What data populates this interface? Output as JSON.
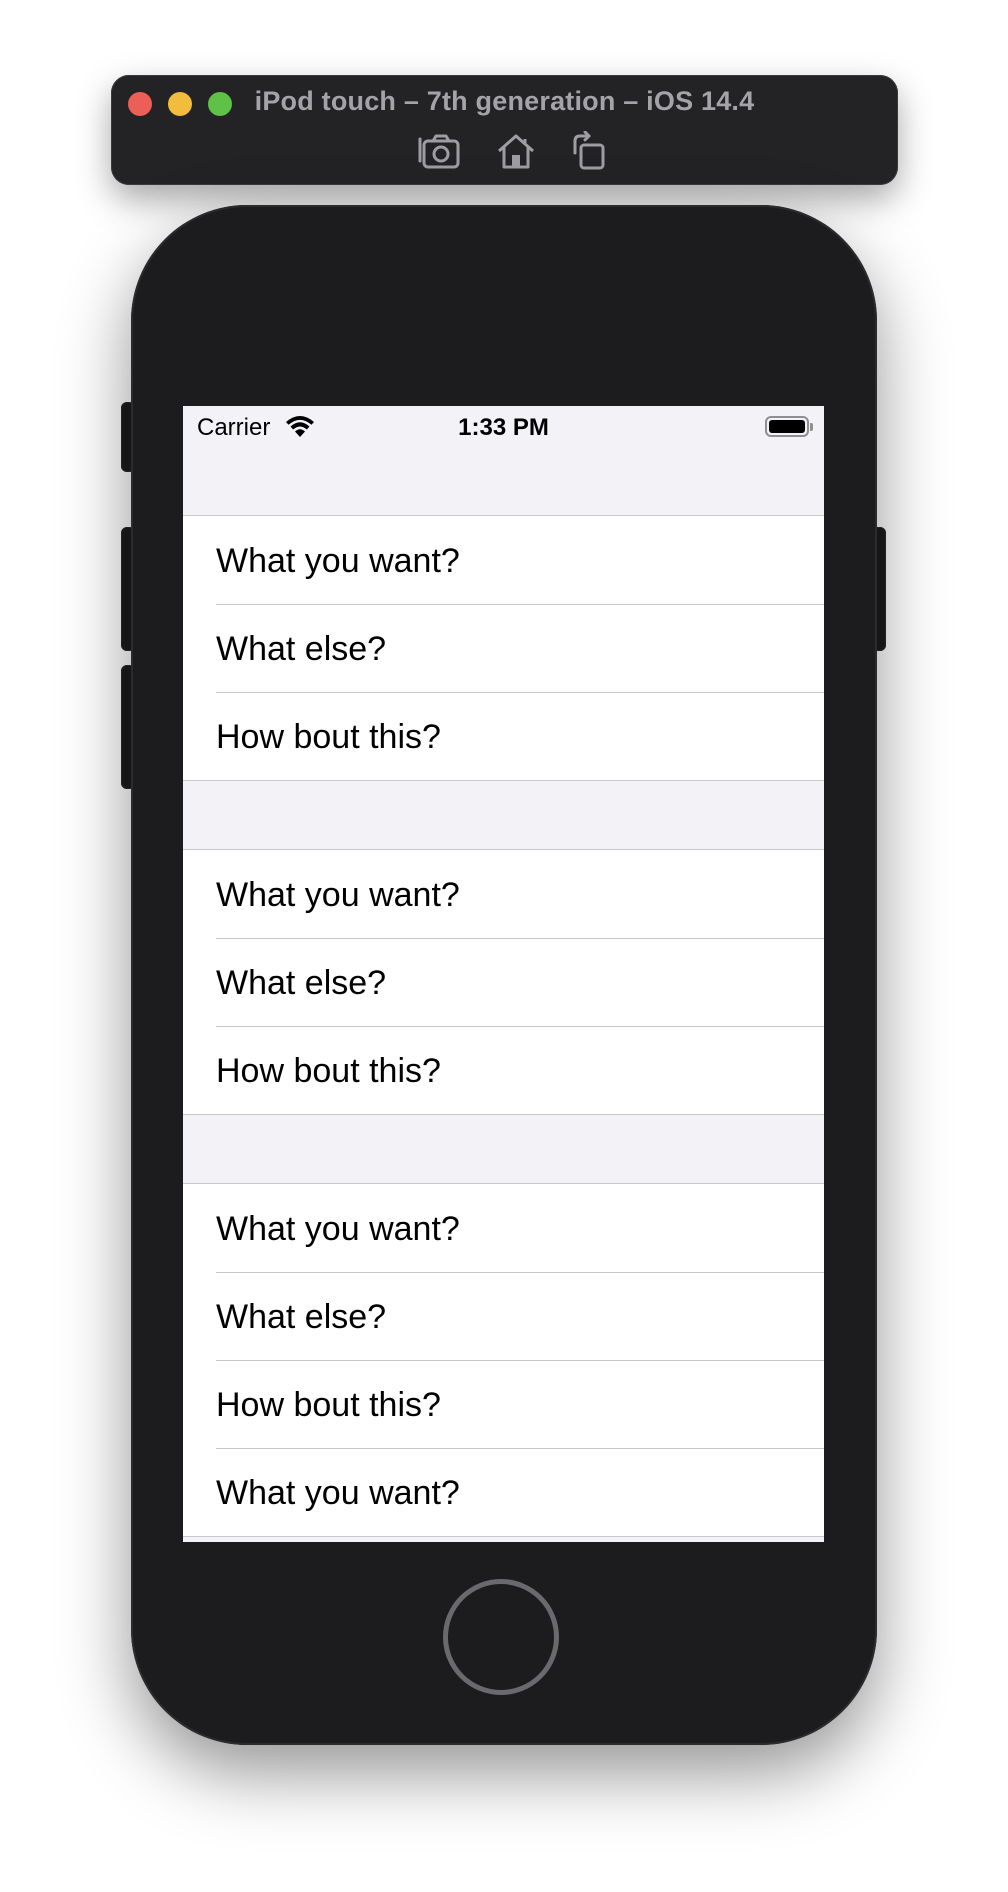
{
  "simulator": {
    "title": "iPod touch – 7th generation – iOS 14.4",
    "toolbar_icons": [
      "screenshot-icon",
      "home-icon",
      "rotate-icon"
    ]
  },
  "status_bar": {
    "carrier": "Carrier",
    "time": "1:33 PM",
    "battery_level": 1.0
  },
  "table": {
    "sections": [
      {
        "rows": [
          {
            "label": "What you want?"
          },
          {
            "label": "What else?"
          },
          {
            "label": "How bout this?"
          }
        ]
      },
      {
        "rows": [
          {
            "label": "What you want?"
          },
          {
            "label": "What else?"
          },
          {
            "label": "How bout this?"
          }
        ]
      },
      {
        "rows": [
          {
            "label": "What you want?"
          },
          {
            "label": "What else?"
          },
          {
            "label": "How bout this?"
          },
          {
            "label": "What you want?"
          }
        ]
      }
    ]
  },
  "colors": {
    "background_grouped": "#f2f2f7",
    "cell_background": "#ffffff",
    "separator": "#c8c7cc",
    "device_body": "#1c1c1e",
    "toolbar": "#232326"
  }
}
